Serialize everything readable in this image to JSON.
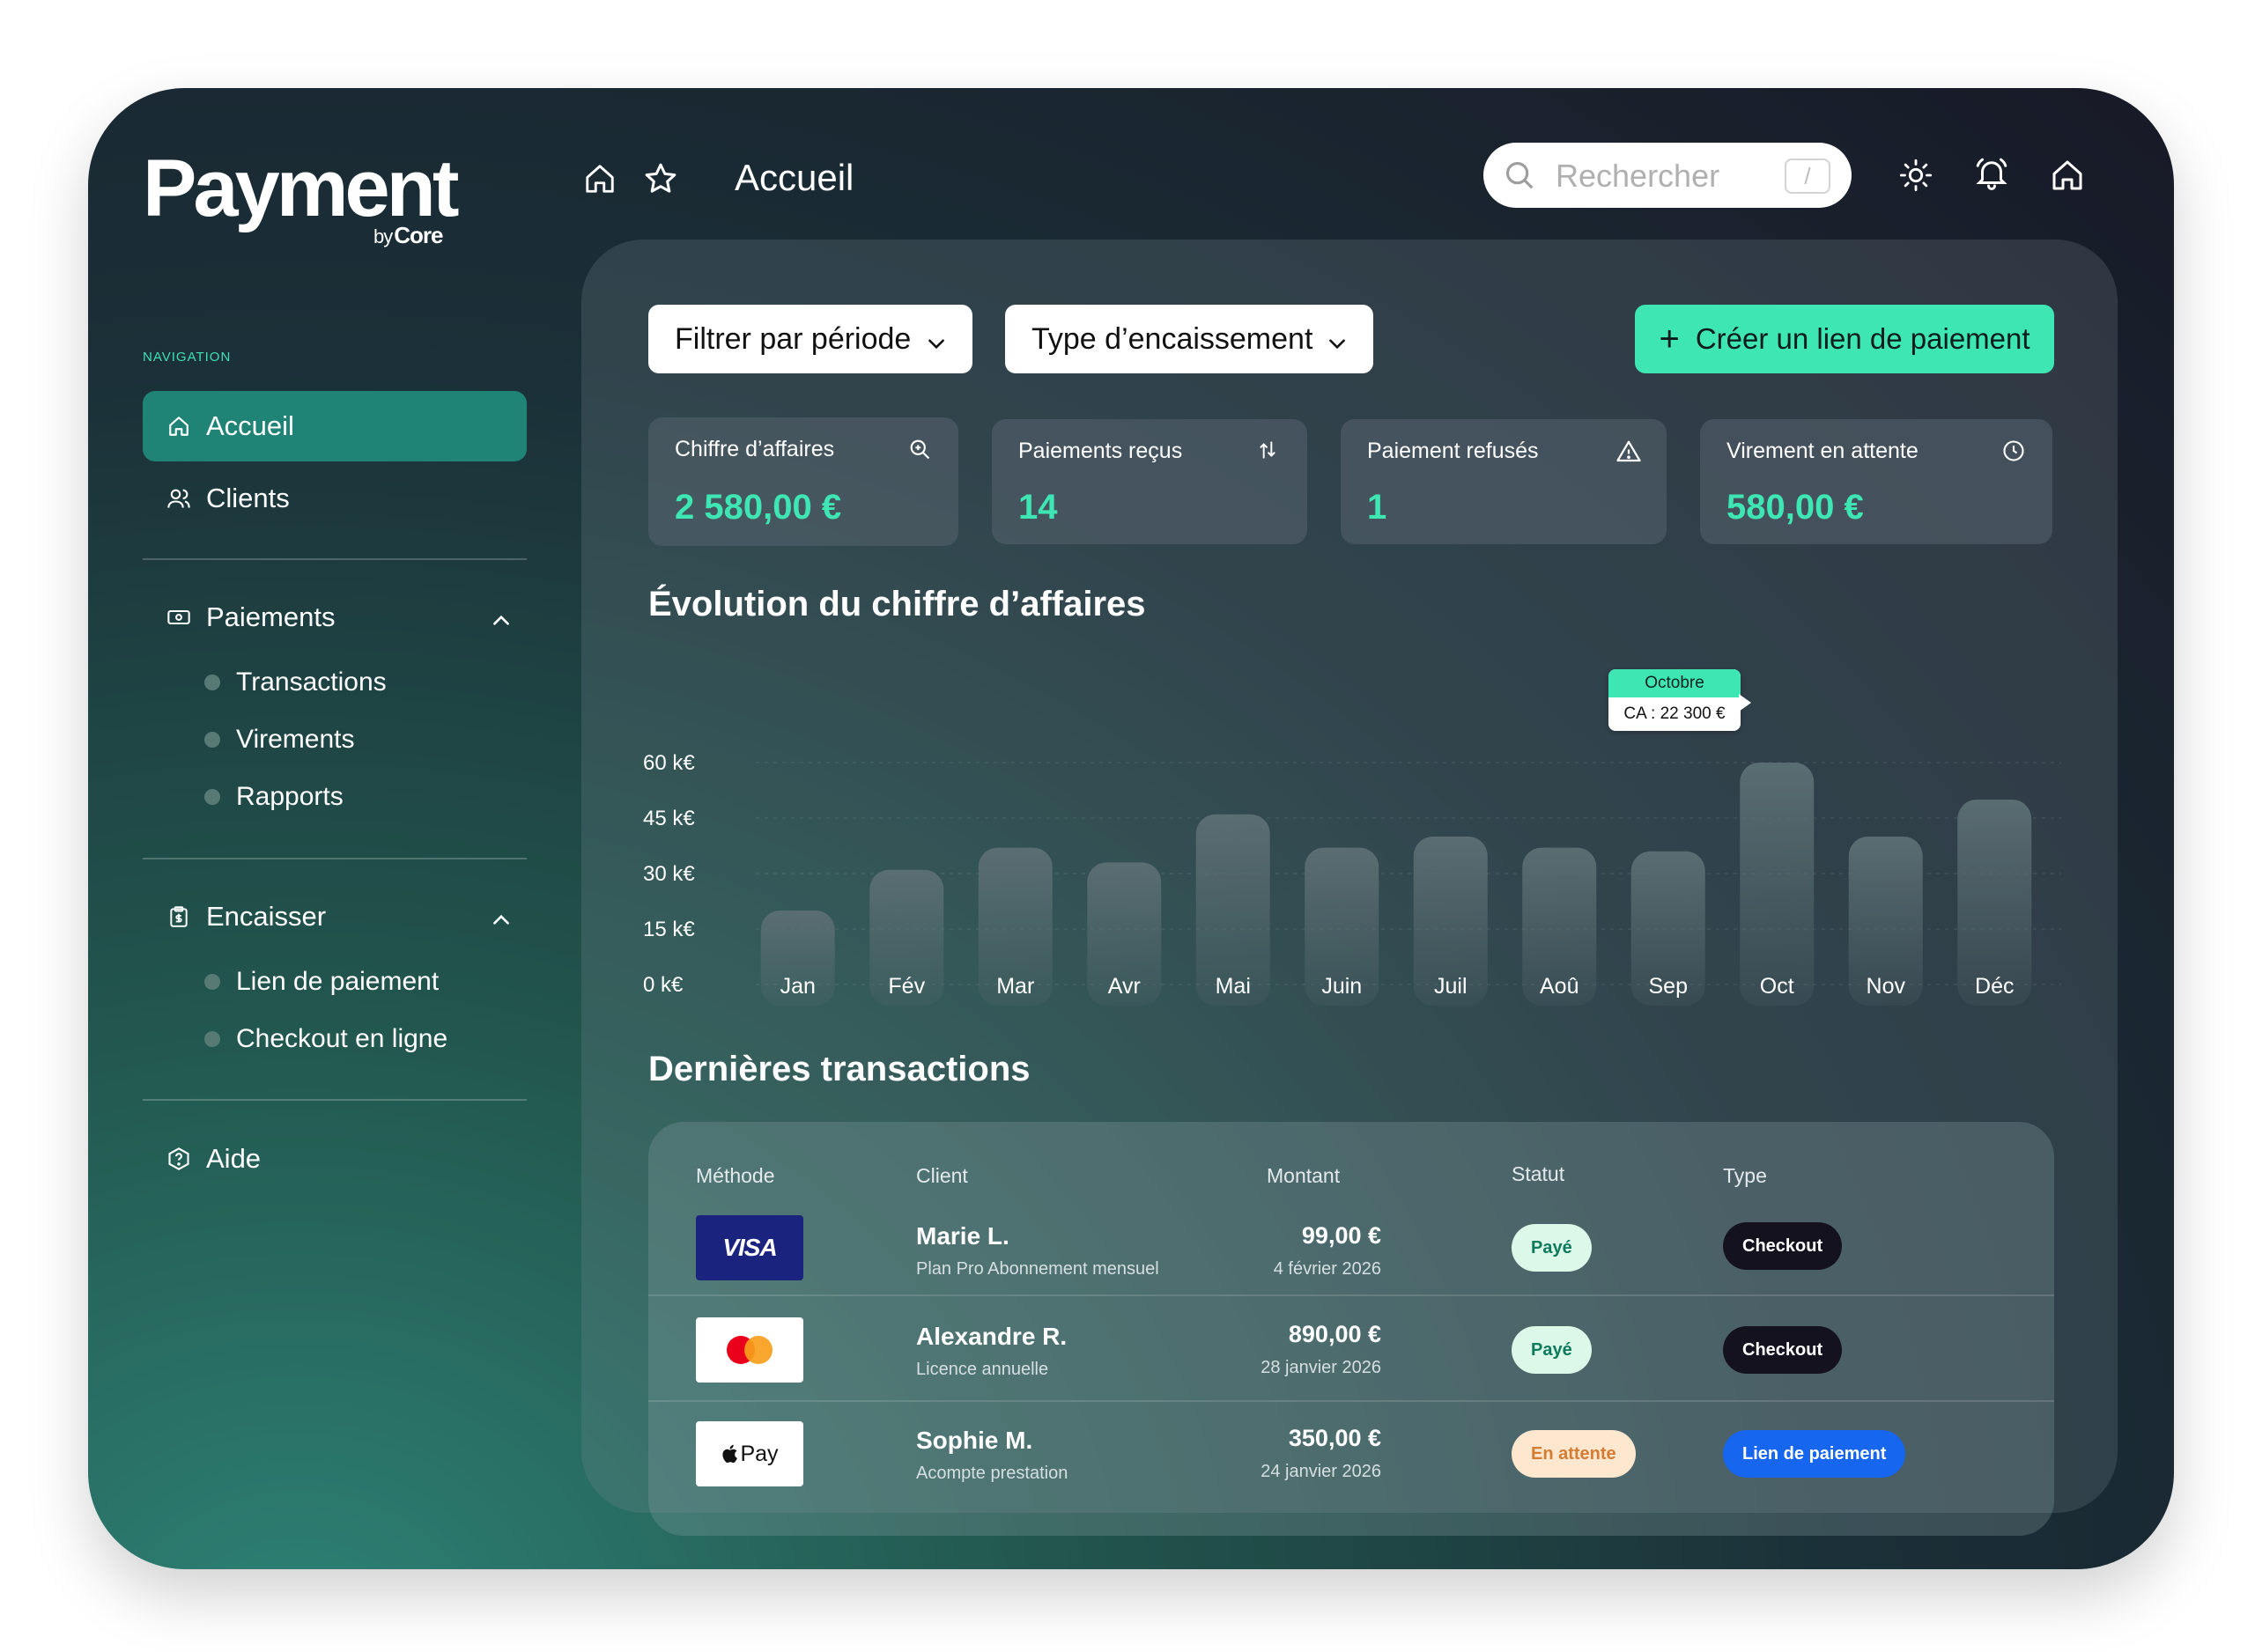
{
  "brand": {
    "name": "Payment",
    "sub_by": "by",
    "sub_name": "Core"
  },
  "header": {
    "title": "Accueil",
    "search_placeholder": "Rechercher",
    "search_shortcut": "/"
  },
  "sidebar": {
    "caption": "NAVIGATION",
    "accueil": "Accueil",
    "clients": "Clients",
    "paiements": {
      "label": "Paiements",
      "items": [
        "Transactions",
        "Virements",
        "Rapports"
      ]
    },
    "encaisser": {
      "label": "Encaisser",
      "items": [
        "Lien de paiement",
        "Checkout en ligne"
      ]
    },
    "aide": "Aide"
  },
  "filters": {
    "period": "Filtrer par période",
    "type": "Type d’encaissement",
    "create": "Créer un lien de paiement",
    "create_icon": "+"
  },
  "kpis": [
    {
      "label": "Chiffre d’affaires",
      "value": "2 580,00 €",
      "icon": "search-zoom-icon"
    },
    {
      "label": "Paiements reçus",
      "value": "14",
      "icon": "swap-arrows-icon"
    },
    {
      "label": "Paiement refusés",
      "value": "1",
      "icon": "warning-icon"
    },
    {
      "label": "Virement en attente",
      "value": "580,00 €",
      "icon": "clock-icon"
    }
  ],
  "chart_title": "Évolution du chiffre d’affaires",
  "chart_data": {
    "type": "bar",
    "categories": [
      "Jan",
      "Fév",
      "Mar",
      "Avr",
      "Mai",
      "Juin",
      "Juil",
      "Aoû",
      "Sep",
      "Oct",
      "Nov",
      "Déc"
    ],
    "values": [
      20,
      31,
      37,
      33,
      46,
      37,
      40,
      37,
      36,
      60,
      40,
      50
    ],
    "yticks": [
      "0 k€",
      "15 k€",
      "30 k€",
      "45 k€",
      "60 k€"
    ],
    "ylim": [
      0,
      60
    ],
    "xlabel": "",
    "ylabel": "",
    "grid": true,
    "tooltip": {
      "title": "Octobre",
      "text": "CA : 22 300 €"
    }
  },
  "transactions": {
    "title": "Dernières transactions",
    "headers": [
      "Méthode",
      "Client",
      "Montant",
      "Statut",
      "Type"
    ],
    "rows": [
      {
        "method": "VISA",
        "client": "Marie L.",
        "desc": "Plan Pro Abonnement mensuel",
        "amount": "99,00 €",
        "date": "4 février 2026",
        "status": "Payé",
        "type": "Checkout"
      },
      {
        "method": "mastercard",
        "client": "Alexandre R.",
        "desc": "Licence annuelle",
        "amount": "890,00 €",
        "date": "28 janvier 2026",
        "status": "Payé",
        "type": "Checkout"
      },
      {
        "method": "Pay",
        "client": "Sophie M.",
        "desc": "Acompte prestation",
        "amount": "350,00 €",
        "date": "24 janvier 2026",
        "status": "En attente",
        "type": "Lien de paiement"
      }
    ]
  },
  "colors": {
    "accent": "#3ee6b4",
    "sidebar_active": "#1f8476",
    "bar": "#5e7277",
    "link_blue": "#1666f0"
  }
}
